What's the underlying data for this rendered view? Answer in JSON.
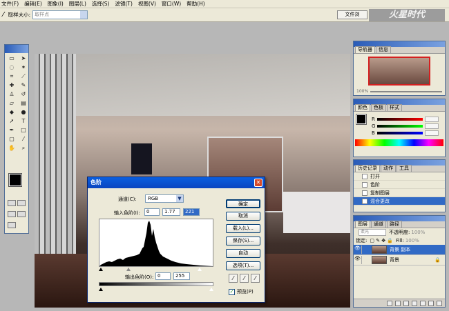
{
  "menu": [
    "文件(F)",
    "编辑(E)",
    "图象(I)",
    "图层(L)",
    "选择(S)",
    "滤镜(T)",
    "视图(V)",
    "窗口(W)",
    "帮助(H)"
  ],
  "options": {
    "label": "取样大小:",
    "value": "取样点"
  },
  "filebrowser": "文件浏",
  "watermark": "火星时代",
  "navigator": {
    "tabs": [
      "导航器",
      "信息"
    ],
    "zoom": "100%"
  },
  "color_panel": {
    "tabs": [
      "颜色",
      "色板",
      "样式"
    ],
    "channels": [
      "R",
      "G",
      "B"
    ]
  },
  "history": {
    "tabs": [
      "历史记录",
      "动作",
      "工具"
    ],
    "items": [
      "打开",
      "色阶",
      "复制图层",
      "混合更改"
    ]
  },
  "layers": {
    "tabs": [
      "图层",
      "通道",
      "路径"
    ],
    "blend_mode": "柔光",
    "opacity_label": "不透明度:",
    "opacity_value": "100%",
    "lock_label": "锁定:",
    "fill_label": "Fill:",
    "fill_value": "100%",
    "items": [
      "背景 副本",
      "背景"
    ]
  },
  "levels_dialog": {
    "title": "色阶",
    "channel_label": "通道(C):",
    "channel_value": "RGB",
    "input_label": "输入色阶(I):",
    "input_values": [
      "0",
      "1.77",
      "221"
    ],
    "output_label": "输出色阶(O):",
    "output_values": [
      "0",
      "255"
    ],
    "buttons": {
      "ok": "确定",
      "cancel": "取消",
      "load": "载入(L)...",
      "save": "保存(S)...",
      "auto": "自动",
      "options": "选项(T)..."
    },
    "preview_label": "预览(P)"
  },
  "colors": {
    "accent": "#316ac5",
    "title_bar": "#0a5fe0",
    "close": "#d64a2a"
  }
}
